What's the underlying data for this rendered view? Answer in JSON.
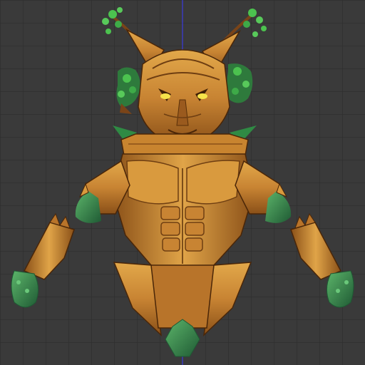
{
  "viewport": {
    "background": "#3a3a3a",
    "grid_color": "#2b2b2b",
    "grid_spacing_note": "grid",
    "vertical_axis_color": "#3a3aff"
  },
  "model": {
    "name_icon": "treant-creature-model",
    "palette": {
      "bark_light": "#d89a3c",
      "bark_mid": "#b8742a",
      "bark_dark": "#6e3e12",
      "bark_outline": "#4a2608",
      "leaf_green": "#3f9a52",
      "leaf_dark": "#1f5a34",
      "foliage_bright": "#4cc24f",
      "branch_brown": "#7a4418",
      "eye_glow": "#f6e34a"
    }
  }
}
